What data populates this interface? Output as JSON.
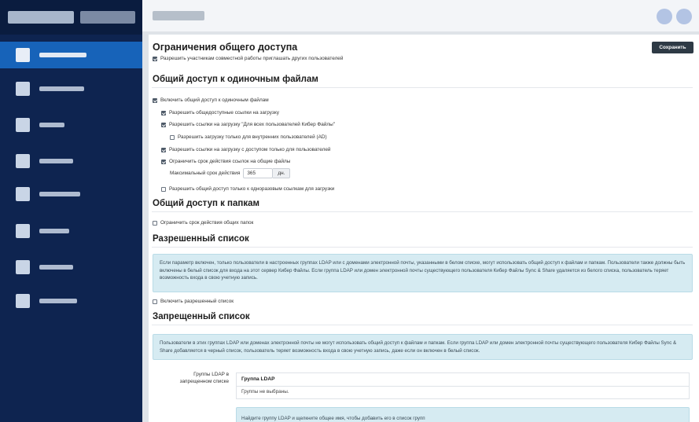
{
  "page": {
    "title": "Ограничения общего доступа",
    "save_label": "Сохранить",
    "collab_invite": "Разрешить участникам совместной работы приглашать других пользователей"
  },
  "single_files": {
    "heading": "Общий доступ к одиночным файлам",
    "enable": "Включить общий доступ к одиночным файлам",
    "public_links": "Разрешить общедоступные ссылки на загрузку",
    "all_users_links": "Разрешить ссылки на загрузку \"Для всех пользователей Кибер Файлы\"",
    "internal_only": "Разрешить загрузку только для внутренних пользователей (AD)",
    "users_only_links": "Разрешить ссылки на загрузку с доступом только для пользователей",
    "limit_expiry": "Ограничить срок действия ссылок на общие файлы",
    "max_expiry_label": "Максимальный срок действия",
    "max_expiry_value": "365",
    "max_expiry_unit": "дн.",
    "one_time_only": "Разрешить общий доступ только к одноразовым ссылкам для загрузки"
  },
  "folders": {
    "heading": "Общий доступ к папкам",
    "limit_expiry": "Ограничить срок действия общих папок"
  },
  "allow_list": {
    "heading": "Разрешенный список",
    "info": "Если параметр включен, только пользователи в настроенных группах LDAP или с доменами электронной почты, указанными в белом списке, могут использовать общий доступ к файлам и папкам. Пользователи также должны быть включены в белый список для входа на этот сервер Кибер Файлы. Если группа LDAP или домен электронной почты существующего пользователя Кибер Файлы Sync & Share удаляется из белого списка, пользователь теряет возможность входа в свою учетную запись.",
    "enable": "Включить разрешенный список"
  },
  "deny_list": {
    "heading": "Запрещенный список",
    "info": "Пользователи в этих группах LDAP или доменах электронной почты не могут использовать общий доступ к файлам и папкам. Если группа LDAP или домен электронной почты существующего пользователя Кибер Файлы Sync & Share добавляется в черный список, пользователь теряет возможность входа в свою учетную запись, даже если он включен в белый список.",
    "ldap_label": "Группы LDAP в запрещенном списке",
    "ldap_head": "Группа LDAP",
    "ldap_empty": "Группы не выбраны.",
    "ldap_hint": "Найдите группу LDAP и щелкните общее имя, чтобы добавить его в список групп"
  },
  "checkboxes": {
    "collab_invite": true,
    "enable_single": true,
    "public_links": true,
    "all_users_links": true,
    "internal_only": false,
    "users_only_links": true,
    "limit_expiry": true,
    "one_time_only": false,
    "folders_limit": false,
    "allow_list": false
  },
  "colors": {
    "sidebar": "#0e2450",
    "sidebar_active": "#1763b9",
    "save_button": "#2e3a45",
    "info_box": "#d6ebf2"
  }
}
